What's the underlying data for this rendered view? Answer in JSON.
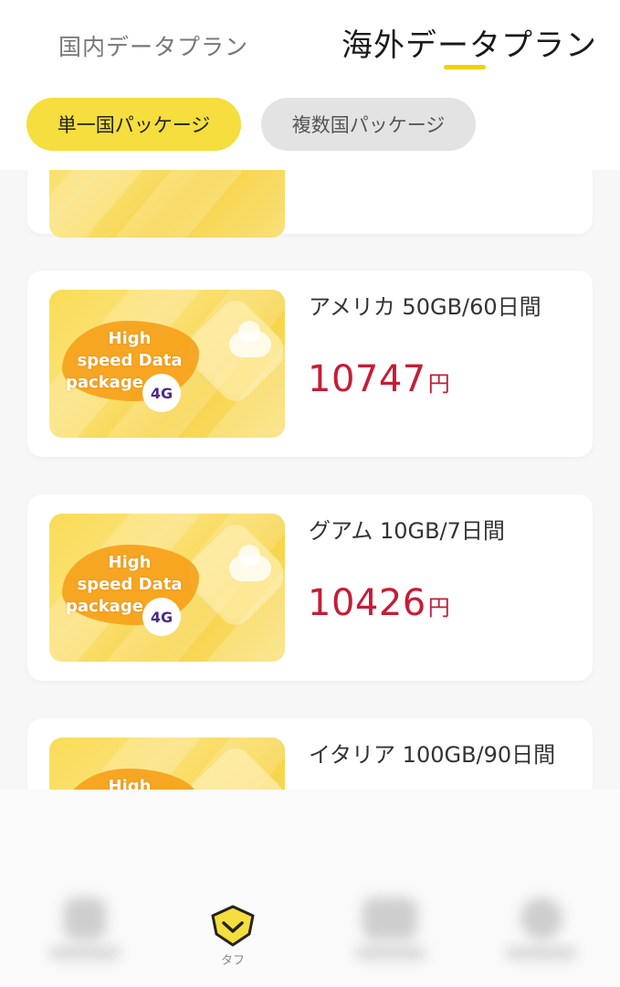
{
  "top_tabs": {
    "domestic": "国内データプラン",
    "overseas": "海外データプラン",
    "active": "overseas"
  },
  "filters": {
    "single": "単一国パッケージ",
    "multi": "複数国パッケージ",
    "active": "single"
  },
  "promo": {
    "line1": "High",
    "line2": "speed Data",
    "line3": "package",
    "badge": "4G"
  },
  "products": [
    {
      "title": "",
      "price": "",
      "currency": ""
    },
    {
      "title": "アメリカ 50GB/60日間",
      "price": "10747",
      "currency": "円"
    },
    {
      "title": "グアム 10GB/7日間",
      "price": "10426",
      "currency": "円"
    },
    {
      "title": "イタリア 100GB/90日間",
      "price": "",
      "currency": ""
    }
  ],
  "bottom_nav": {
    "active_label": "タフ"
  },
  "colors": {
    "accent_yellow": "#f5de3d",
    "price_red": "#c51d36"
  }
}
